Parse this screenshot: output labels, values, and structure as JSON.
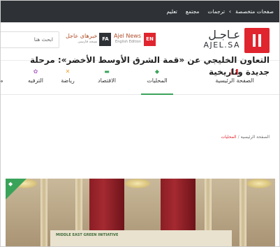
{
  "topbar": {
    "links": [
      "صفحات متخصصة",
      "ترجمات",
      "مجتمع",
      "تعليم"
    ],
    "chevron": "›"
  },
  "header": {
    "logo_ar": "عـاجـل",
    "logo_lat": "AJEL.SA",
    "edition_en": {
      "tag": "EN",
      "title": "Ajel News",
      "subtitle": "English Edition"
    },
    "edition_fa": {
      "tag": "FA",
      "title": "خبرهای عاجل",
      "subtitle": "نسخه فارسی"
    },
    "search_placeholder": "ابحث هنا"
  },
  "nav": {
    "items": [
      {
        "label": "الصفحة الرئيسية",
        "icon": "home-bars-icon",
        "active": false
      },
      {
        "label": "المحليات",
        "icon": "local-icon",
        "active": true
      },
      {
        "label": "الاقتصاد",
        "icon": "money-icon",
        "active": false
      },
      {
        "label": "رياضة",
        "icon": "sport-icon",
        "active": false
      },
      {
        "label": "الترفيه",
        "icon": "entertainment-icon",
        "active": false
      },
      {
        "label": "م",
        "icon": "",
        "active": false
      }
    ],
    "accent": "#3aa35a",
    "brand": "#e0252f"
  },
  "article": {
    "breadcrumb_home": "الصفحة الرئيسية",
    "breadcrumb_sep": "/",
    "breadcrumb_current": "المحليات",
    "title": "التعاون الخليجي عن «قمة الشرق الأوسط الأخضر»: مرحلة جديدة وتاريخية",
    "hero_banner_text": "MIDDLE EAST GREEN INITIATIVE"
  }
}
